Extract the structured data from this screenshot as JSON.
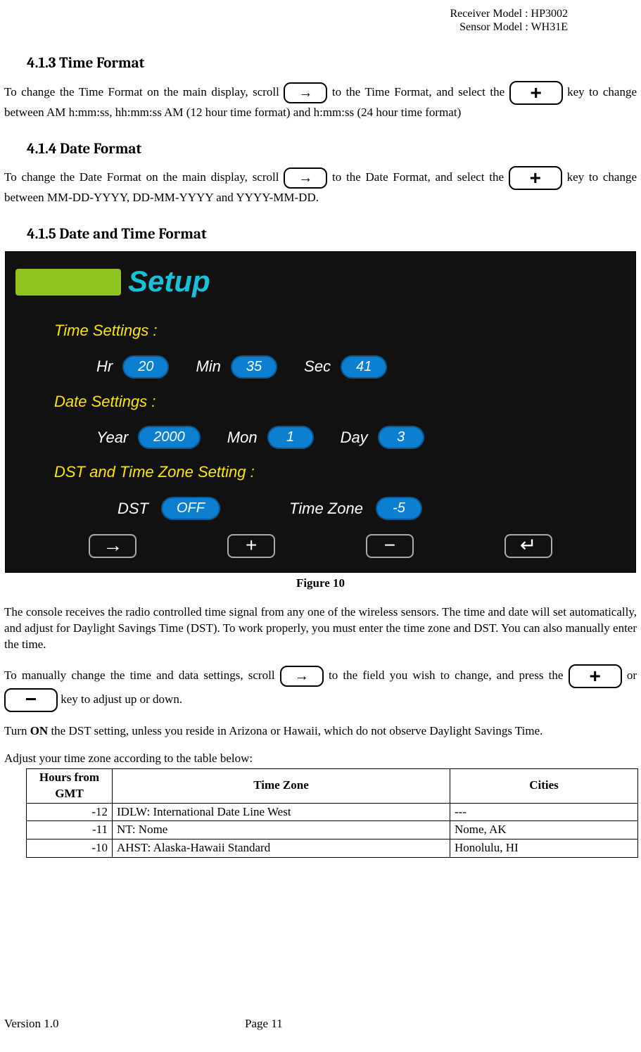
{
  "header": {
    "receiver": "Receiver Model : HP3002",
    "sensor": "Sensor Model : WH31E"
  },
  "s413": {
    "heading": "4.1.3   Time Format",
    "p1a": "To change the Time Format on the main display, scroll ",
    "p1b": " to the Time Format, and select the ",
    "p1c": " key to change between AM h:mm:ss, hh:mm:ss AM (12 hour time format) and h:mm:ss (24 hour time format)"
  },
  "s414": {
    "heading": "4.1.4   Date Format",
    "p1a": "To change the Date Format on the main display, scroll ",
    "p1b": " to the Date Format, and select the ",
    "p1c": " key to change between MM-DD-YYYY, DD-MM-YYYY and YYYY-MM-DD."
  },
  "s415": {
    "heading": "4.1.5   Date and Time Format"
  },
  "setup": {
    "title": "Setup",
    "time_label": "Time Settings :",
    "hr_label": "Hr",
    "hr_val": "20",
    "min_label": "Min",
    "min_val": "35",
    "sec_label": "Sec",
    "sec_val": "41",
    "date_label": "Date Settings :",
    "year_label": "Year",
    "year_val": "2000",
    "mon_label": "Mon",
    "mon_val": "1",
    "day_label": "Day",
    "day_val": "3",
    "dst_section_label": "DST and Time Zone Setting :",
    "dst_label": "DST",
    "dst_val": "OFF",
    "tz_label": "Time Zone",
    "tz_val": "-5",
    "softkeys": {
      "arrow": "→",
      "plus": "+",
      "minus": "−",
      "enter": "↵"
    }
  },
  "figure_caption": "Figure 10",
  "after_fig": {
    "p1": "The console receives the radio controlled time signal from any one of the wireless sensors. The time and date will set automatically, and adjust for Daylight Savings Time (DST). To work properly, you must enter the time zone and DST. You can also manually enter the time.",
    "p2a": "To manually change the time and data settings, scroll ",
    "p2b": " to the field you wish to change, and press the ",
    "p2c": " or ",
    "p2d": " key to adjust up or down.",
    "p3a": "Turn ",
    "p3b": "ON",
    "p3c": " the DST setting, unless you reside in Arizona or Hawaii, which do not observe Daylight Savings Time.",
    "p4": "Adjust your time zone according to the table below:"
  },
  "table": {
    "headers": {
      "h1": "Hours from GMT",
      "h2": "Time Zone",
      "h3": "Cities"
    },
    "rows": [
      {
        "h": "-12",
        "tz": "IDLW: International Date Line West",
        "c": "---"
      },
      {
        "h": "-11",
        "tz": "NT: Nome",
        "c": "Nome, AK"
      },
      {
        "h": "-10",
        "tz": "AHST: Alaska-Hawaii Standard",
        "c": "Honolulu, HI"
      }
    ]
  },
  "footer": {
    "version": "Version 1.0",
    "page": "Page 11"
  }
}
